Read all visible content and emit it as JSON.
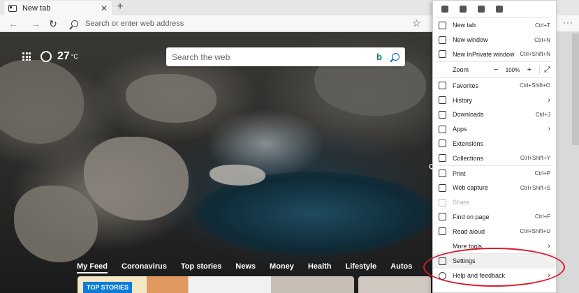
{
  "tab": {
    "title": "New tab",
    "close": "✕",
    "new_tab": "+"
  },
  "address_bar": {
    "placeholder": "Search or enter web address"
  },
  "nav": {
    "back": "←",
    "forward": "→",
    "refresh": "↻",
    "star": "☆",
    "more": "···"
  },
  "weather": {
    "temperature": "27",
    "unit": "°C"
  },
  "search": {
    "placeholder": "Search the web",
    "bing": "b"
  },
  "feed": {
    "tabs": [
      "My Feed",
      "Coronavirus",
      "Top stories",
      "News",
      "Money",
      "Health",
      "Lifestyle",
      "Autos"
    ],
    "badge": "TOP STORIES"
  },
  "side_letter": "Q",
  "menu": {
    "items": [
      {
        "label": "New tab",
        "shortcut": "Ctrl+T"
      },
      {
        "label": "New window",
        "shortcut": "Ctrl+N"
      },
      {
        "label": "New InPrivate window",
        "shortcut": "Ctrl+Shift+N"
      }
    ],
    "zoom": {
      "label": "Zoom",
      "minus": "−",
      "value": "100%",
      "plus": "+",
      "fullscreen": "⤢"
    },
    "items2": [
      {
        "label": "Favorites",
        "shortcut": "Ctrl+Shift+O"
      },
      {
        "label": "History",
        "arrow": "›"
      },
      {
        "label": "Downloads",
        "shortcut": "Ctrl+J"
      },
      {
        "label": "Apps",
        "arrow": "›"
      },
      {
        "label": "Extensions"
      },
      {
        "label": "Collections",
        "shortcut": "Ctrl+Shift+Y"
      }
    ],
    "items3": [
      {
        "label": "Print",
        "shortcut": "Ctrl+P"
      },
      {
        "label": "Web capture",
        "shortcut": "Ctrl+Shift+S"
      },
      {
        "label": "Share"
      },
      {
        "label": "Find on page",
        "shortcut": "Ctrl+F"
      },
      {
        "label": "Read aloud",
        "shortcut": "Ctrl+Shift+U"
      },
      {
        "label": "More tools",
        "arrow": "›"
      }
    ],
    "items4": [
      {
        "label": "Settings"
      },
      {
        "label": "Help and feedback",
        "arrow": "›"
      }
    ]
  },
  "colors": {
    "annotation": "#d8192b",
    "accent": "#0067b8",
    "badge": "#0a7bd6"
  }
}
